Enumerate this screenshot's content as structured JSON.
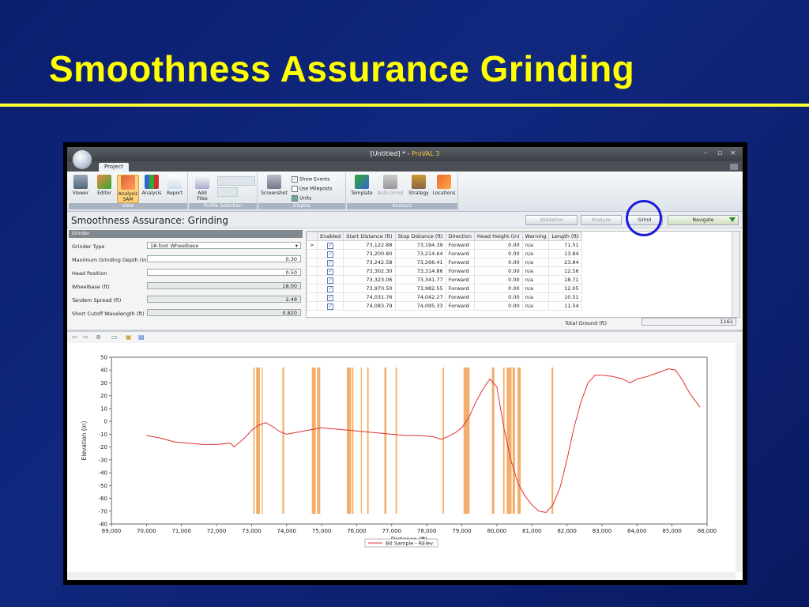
{
  "slide": {
    "title": "Smoothness Assurance Grinding"
  },
  "window": {
    "title_prefix": "[Untitled] * - ",
    "title_app": "ProVAL 3",
    "tab": "Project",
    "controls": {
      "minimize": "–",
      "restore": "▫",
      "close": "×"
    }
  },
  "ribbon": {
    "groups": {
      "view": "View",
      "profile_selection": "Profile Selection",
      "display": "Display",
      "analysis": "Analysis"
    },
    "buttons": {
      "viewer": "Viewer",
      "editor": "Editor",
      "analysis_sam_line1": "Analysis",
      "analysis_sam_line2": "SAM",
      "analysis": "Analysis",
      "report": "Report",
      "add_files": "Add Files",
      "screenshot": "Screenshot",
      "template": "Template",
      "auto_grind": "Auto Grind",
      "strategy": "Strategy",
      "locations": "Locations"
    },
    "display_options": {
      "show_events": "Show Events",
      "use_mileposts": "Use Mileposts",
      "units": "Units"
    }
  },
  "header": {
    "title": "Smoothness Assurance: Grinding",
    "validation": "Validation",
    "analyze": "Analyze",
    "grind": "Grind",
    "navigate": "Navigate"
  },
  "grinder": {
    "panel_title": "Grinder",
    "rows": [
      {
        "label": "Grinder Type",
        "value": "18-foot Wheelbase"
      },
      {
        "label": "Maximum Grinding Depth (in)",
        "value": "0.30"
      },
      {
        "label": "Head Position",
        "value": "0.50"
      },
      {
        "label": "Wheelbase (ft)",
        "value": "18.00"
      },
      {
        "label": "Tandem Spread (ft)",
        "value": "2.49"
      },
      {
        "label": "Short Cutoff Wavelength (ft)",
        "value": "0.820"
      }
    ]
  },
  "table": {
    "columns": [
      "Enabled",
      "Start Distance (ft)",
      "Stop Distance (ft)",
      "Direction",
      "Head Height (in)",
      "Warning",
      "Length (ft)"
    ],
    "rows": [
      [
        "73,122.88",
        "73,194.39",
        "Forward",
        "0.00",
        "n/a",
        "71.51"
      ],
      [
        "73,200.80",
        "73,214.64",
        "Forward",
        "0.00",
        "n/a",
        "13.84"
      ],
      [
        "73,242.58",
        "73,266.41",
        "Forward",
        "0.00",
        "n/a",
        "23.84"
      ],
      [
        "73,302.30",
        "73,314.86",
        "Forward",
        "0.00",
        "n/a",
        "12.56"
      ],
      [
        "73,323.06",
        "73,341.77",
        "Forward",
        "0.00",
        "n/a",
        "18.71"
      ],
      [
        "73,970.50",
        "73,982.55",
        "Forward",
        "0.00",
        "n/a",
        "12.05"
      ],
      [
        "74,031.76",
        "74,042.27",
        "Forward",
        "0.00",
        "n/a",
        "10.51"
      ],
      [
        "74,083.79",
        "74,095.33",
        "Forward",
        "0.00",
        "n/a",
        "11.54"
      ]
    ],
    "total_label": "Total Ground (ft)",
    "total_value": "1161"
  },
  "colors": {
    "slide_title": "#ffff00",
    "profile_line": "#e03030",
    "grind_zone": "#f0a050",
    "highlight_ring": "#1a1ae0"
  },
  "chart_data": {
    "type": "line",
    "xlabel": "Distance (ft)",
    "ylabel": "Elevation (in)",
    "xlim": [
      69000,
      86000
    ],
    "ylim": [
      -80,
      50
    ],
    "xticks": [
      69000,
      70000,
      71000,
      72000,
      73000,
      74000,
      75000,
      76000,
      77000,
      78000,
      79000,
      80000,
      81000,
      82000,
      83000,
      84000,
      85000,
      86000
    ],
    "xtick_labels": [
      "69,000",
      "70,000",
      "71,000",
      "72,000",
      "73,000",
      "74,000",
      "75,000",
      "76,000",
      "77,000",
      "78,000",
      "79,000",
      "80,000",
      "81,000",
      "82,000",
      "83,000",
      "84,000",
      "85,000",
      "86,000"
    ],
    "yticks": [
      50,
      40,
      30,
      20,
      10,
      0,
      -10,
      -20,
      -30,
      -40,
      -50,
      -60,
      -70,
      -80
    ],
    "grid": false,
    "legend": "bottom-center",
    "series": [
      {
        "name": "Bit Sample - RElev.",
        "x": [
          70000,
          70400,
          70800,
          71200,
          71600,
          72000,
          72400,
          72500,
          72800,
          73000,
          73200,
          73400,
          73600,
          73800,
          74000,
          74400,
          74800,
          75000,
          75400,
          75800,
          76200,
          76600,
          77000,
          77400,
          77800,
          78200,
          78400,
          78600,
          78800,
          79000,
          79200,
          79400,
          79600,
          79800,
          80000,
          80200,
          80400,
          80600,
          80800,
          81000,
          81200,
          81400,
          81600,
          81800,
          82000,
          82200,
          82400,
          82600,
          82800,
          83000,
          83300,
          83600,
          83800,
          84000,
          84300,
          84600,
          84900,
          85100,
          85300,
          85500,
          85800
        ],
        "y": [
          -11,
          -13,
          -16,
          -17,
          -18,
          -18,
          -17,
          -20,
          -13,
          -7,
          -3,
          -1,
          -4,
          -8,
          -10,
          -8,
          -6,
          -5,
          -6,
          -7,
          -8,
          -9,
          -10,
          -11,
          -11,
          -12,
          -14,
          -12,
          -9,
          -5,
          3,
          15,
          25,
          33,
          27,
          -5,
          -30,
          -48,
          -58,
          -65,
          -70,
          -71,
          -65,
          -52,
          -30,
          -5,
          15,
          30,
          36,
          36,
          35,
          33,
          30,
          33,
          35,
          38,
          41,
          40,
          32,
          22,
          11
        ]
      }
    ],
    "grind_zones_ft": [
      [
        73050,
        73090
      ],
      [
        73130,
        73240
      ],
      [
        73290,
        73320
      ],
      [
        73880,
        73930
      ],
      [
        74720,
        74830
      ],
      [
        74870,
        74960
      ],
      [
        75720,
        75840
      ],
      [
        75870,
        75910
      ],
      [
        76120,
        76150
      ],
      [
        76300,
        76340
      ],
      [
        76790,
        76850
      ],
      [
        77110,
        77150
      ],
      [
        78450,
        78490
      ],
      [
        79050,
        79220
      ],
      [
        79860,
        79930
      ],
      [
        80180,
        80220
      ],
      [
        80280,
        80420
      ],
      [
        80450,
        80520
      ],
      [
        80590,
        80680
      ],
      [
        81560,
        81610
      ]
    ]
  }
}
